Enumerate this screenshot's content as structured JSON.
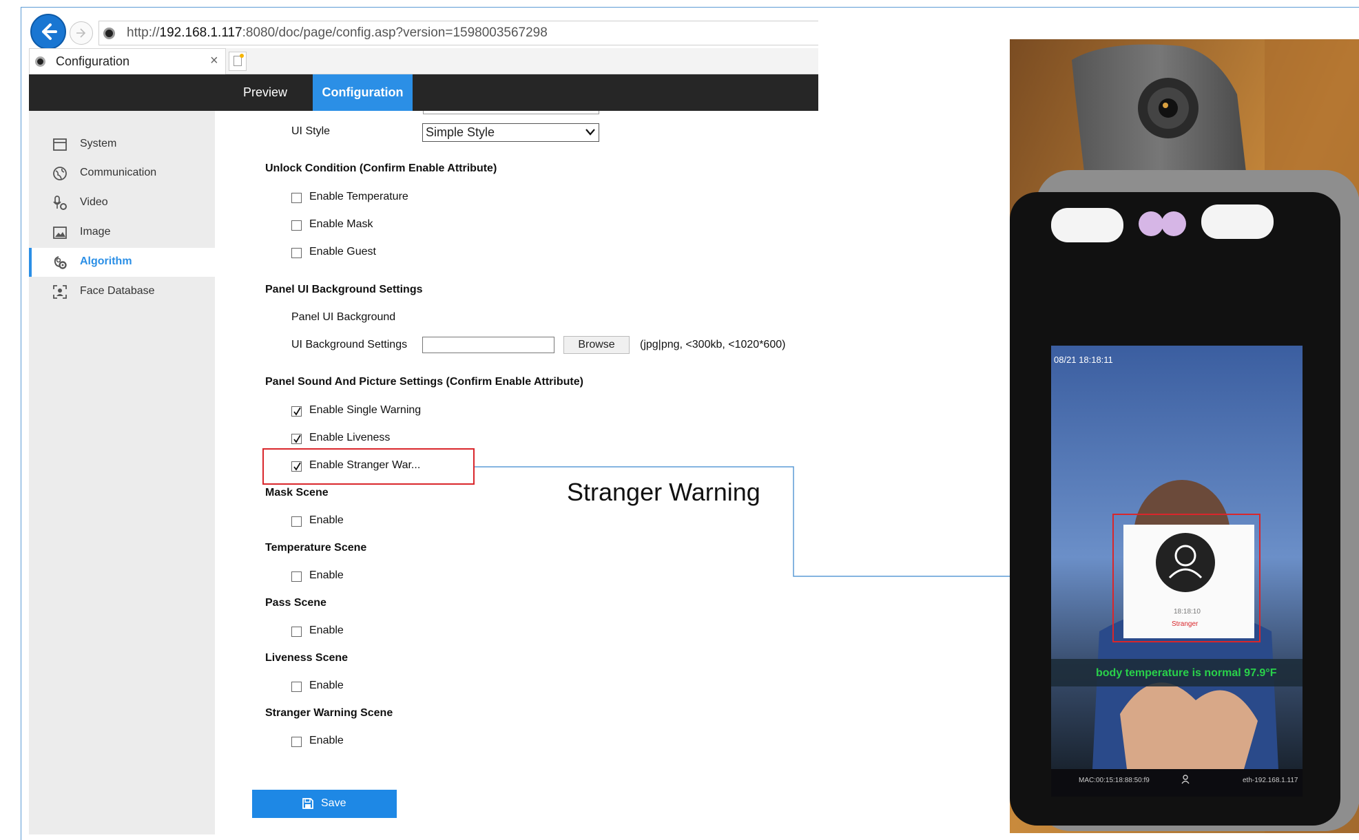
{
  "browser": {
    "url_prefix": "http://",
    "url_host": "192.168.1.117",
    "url_rest": ":8080/doc/page/config.asp?version=1598003567298",
    "tab_title": "Configuration",
    "tab_close": "×"
  },
  "header": {
    "tabs": [
      {
        "label": "Preview"
      },
      {
        "label": "Configuration"
      }
    ]
  },
  "sidebar": {
    "items": [
      {
        "label": "System",
        "icon": "window-icon"
      },
      {
        "label": "Communication",
        "icon": "globe-icon"
      },
      {
        "label": "Video",
        "icon": "microphone-camera-icon"
      },
      {
        "label": "Image",
        "icon": "picture-icon"
      },
      {
        "label": "Algorithm",
        "icon": "algorithm-gear-icon",
        "active": true
      },
      {
        "label": "Face Database",
        "icon": "face-frame-icon"
      }
    ]
  },
  "form": {
    "ui_style_label": "UI Style",
    "ui_style_value": "Simple Style",
    "unlock_heading": "Unlock Condition (Confirm Enable Attribute)",
    "unlock_options": [
      {
        "label": "Enable Temperature",
        "checked": false
      },
      {
        "label": "Enable Mask",
        "checked": false
      },
      {
        "label": "Enable Guest",
        "checked": false
      }
    ],
    "panel_bg_heading": "Panel UI Background Settings",
    "panel_bg_label": "Panel UI Background",
    "ui_bg_settings_label": "UI Background Settings",
    "browse_label": "Browse",
    "file_hint": "(jpg|png, <300kb, <1020*600)",
    "sound_heading": "Panel Sound And Picture Settings (Confirm Enable Attribute)",
    "sound_options": [
      {
        "label": "Enable Single Warning",
        "checked": true
      },
      {
        "label": "Enable Liveness",
        "checked": true
      },
      {
        "label": "Enable Stranger War...",
        "checked": true
      }
    ],
    "scenes": [
      {
        "heading": "Mask Scene",
        "option": "Enable",
        "checked": false
      },
      {
        "heading": "Temperature Scene",
        "option": "Enable",
        "checked": false
      },
      {
        "heading": "Pass Scene",
        "option": "Enable",
        "checked": false
      },
      {
        "heading": "Liveness Scene",
        "option": "Enable",
        "checked": false
      },
      {
        "heading": "Stranger Warning Scene",
        "option": "Enable",
        "checked": false
      }
    ],
    "save_label": "Save"
  },
  "annotation": {
    "callout_text": "Stranger Warning",
    "highlight_color": "#d9262b",
    "connector_color": "#5b9bd5"
  },
  "device": {
    "timestamp": "08/21 18:18:11",
    "popup_time": "18:18:10",
    "popup_status": "Stranger",
    "temperature_message": "body temperature is normal 97.9°F",
    "mac": "MAC:00:15:18:88:50:f9",
    "network": "eth-192.168.1.117"
  },
  "colors": {
    "accent": "#2b8fe6",
    "header_bg": "#262626",
    "sidebar_bg": "#ececec",
    "temperature_text": "#29d14a"
  }
}
